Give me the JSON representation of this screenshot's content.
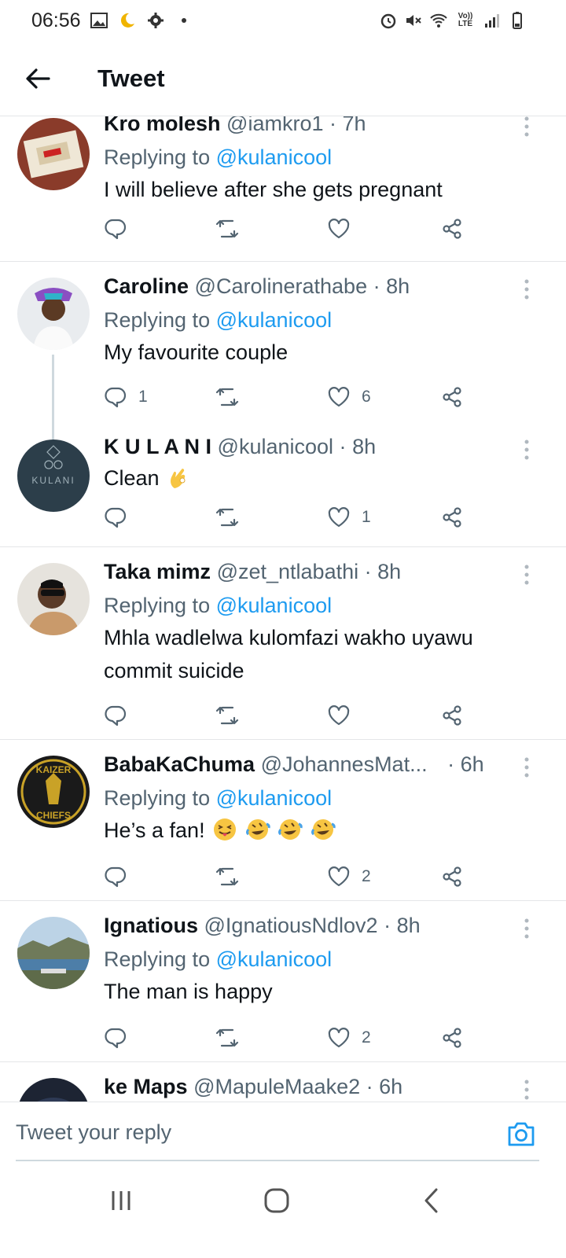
{
  "status_bar": {
    "time": "06:56",
    "network_label": "Vo)) LTE"
  },
  "app_bar": {
    "title": "Tweet"
  },
  "tweets": [
    {
      "name": "Kro molesh",
      "username": "@iamkro1",
      "time": "7h",
      "replying_label": "Replying to",
      "replying_to": "@kulanicool",
      "text": "I will believe after she gets pregnant",
      "replies": "",
      "likes": ""
    },
    {
      "name": "Caroline",
      "username": "@Carolinerathabe",
      "time": "8h",
      "replying_label": "Replying to",
      "replying_to": "@kulanicool",
      "text": "My favourite couple",
      "replies": "1",
      "likes": "6"
    },
    {
      "name": "K U L A N I",
      "username": "@kulanicool",
      "time": "8h",
      "text": "Clean",
      "replies": "",
      "likes": "1",
      "avatar_text": "KULANI"
    },
    {
      "name": "Taka mimz",
      "username": "@zet_ntlabathi",
      "time": "8h",
      "replying_label": "Replying to",
      "replying_to": "@kulanicool",
      "text": "Mhla wadlelwa kulomfazi wakho uyawu commit suicide",
      "replies": "",
      "likes": ""
    },
    {
      "name": "BabaKaChuma",
      "username": "@JohannesMat...",
      "time": "6h",
      "replying_label": "Replying to",
      "replying_to": "@kulanicool",
      "text": "He’s a fan!",
      "replies": "",
      "likes": "2",
      "avatar_text_top": "KAIZER",
      "avatar_text_bottom": "CHIEFS"
    },
    {
      "name": "Ignatious",
      "username": "@IgnatiousNdlov2",
      "time": "8h",
      "replying_label": "Replying to",
      "replying_to": "@kulanicool",
      "text": "The man is happy",
      "replies": "",
      "likes": "2"
    },
    {
      "name": "ke Maps",
      "username": "@MapuleMaake2",
      "time": "6h"
    }
  ],
  "composer": {
    "placeholder": "Tweet your reply"
  },
  "colors": {
    "accent": "#1d9bf0",
    "secondary_text": "#536471",
    "divider": "#e4e6e8"
  }
}
